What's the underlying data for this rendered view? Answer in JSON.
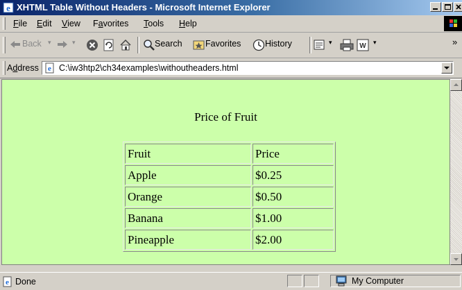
{
  "window": {
    "title": "XHTML Table Without Headers - Microsoft Internet Explorer"
  },
  "menu": {
    "items": [
      {
        "key": "F",
        "rest": "ile"
      },
      {
        "key": "E",
        "rest": "dit"
      },
      {
        "key": "V",
        "rest": "iew"
      },
      {
        "pre": "F",
        "key": "a",
        "rest": "vorites"
      },
      {
        "key": "T",
        "rest": "ools"
      },
      {
        "key": "H",
        "rest": "elp"
      }
    ]
  },
  "toolbar": {
    "back_label": "Back",
    "search_label": "Search",
    "favorites_label": "Favorites",
    "history_label": "History"
  },
  "address": {
    "label_prefix": "A",
    "label_key": "d",
    "label_rest": "dress",
    "url": "C:\\iw3htp2\\ch34examples\\withoutheaders.html"
  },
  "page": {
    "caption": "Price of Fruit",
    "table": {
      "rows": [
        [
          "Fruit",
          "Price"
        ],
        [
          "Apple",
          "$0.25"
        ],
        [
          "Orange",
          "$0.50"
        ],
        [
          "Banana",
          "$1.00"
        ],
        [
          "Pineapple",
          "$2.00"
        ]
      ]
    },
    "background": "#ccffaa"
  },
  "status": {
    "text": "Done",
    "zone": "My Computer"
  }
}
